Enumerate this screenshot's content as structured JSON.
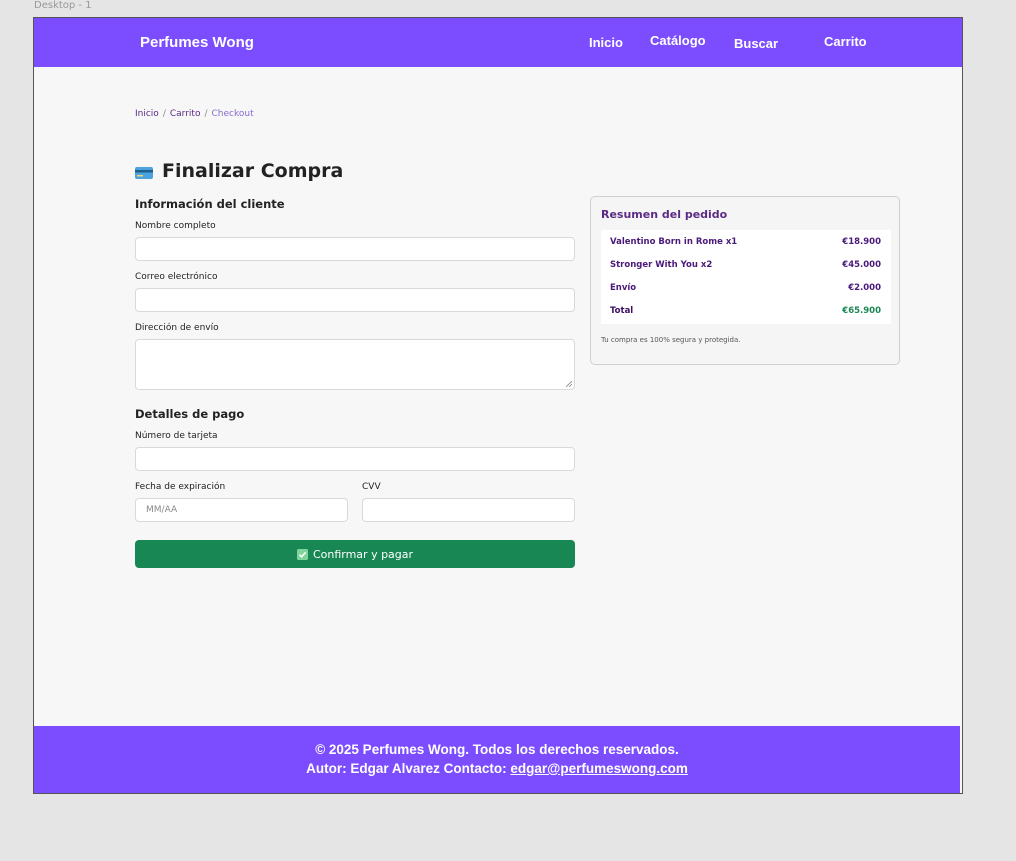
{
  "canvas": {
    "frame_label": "Desktop - 1"
  },
  "navbar": {
    "brand": "Perfumes Wong",
    "links": [
      "Inicio",
      "Catálogo",
      "Buscar",
      "Carrito"
    ]
  },
  "breadcrumb": {
    "items": [
      "Inicio",
      "Carrito",
      "Checkout"
    ],
    "separator": "/"
  },
  "page": {
    "title": "Finalizar Compra",
    "title_icon": "credit-card-icon"
  },
  "customer": {
    "section_title": "Información del cliente",
    "name_label": "Nombre completo",
    "email_label": "Correo electrónico",
    "address_label": "Dirección de envío"
  },
  "payment": {
    "section_title": "Detalles de pago",
    "card_label": "Número de tarjeta",
    "expiry_label": "Fecha de expiración",
    "expiry_placeholder": "MM/AA",
    "cvv_label": "CVV",
    "submit_label": "Confirmar y pagar",
    "submit_icon": "check-box-icon"
  },
  "summary": {
    "title": "Resumen del pedido",
    "items": [
      {
        "name": "Valentino Born in Rome x1",
        "price": "€18.900"
      },
      {
        "name": "Stronger With You x2",
        "price": "€45.000"
      },
      {
        "name": "Envío",
        "price": "€2.000"
      },
      {
        "name": "Total",
        "price": "€65.900"
      }
    ],
    "note": "Tu compra es 100% segura y protegida."
  },
  "footer": {
    "line1": "© 2025 Perfumes Wong. Todos los derechos reservados.",
    "line2_prefix": "Autor: Edgar Alvarez Contacto: ",
    "email": "edgar@perfumeswong.com"
  },
  "colors": {
    "brand": "#7c4dff",
    "success": "#198754",
    "accent_text": "#5b2a86"
  }
}
